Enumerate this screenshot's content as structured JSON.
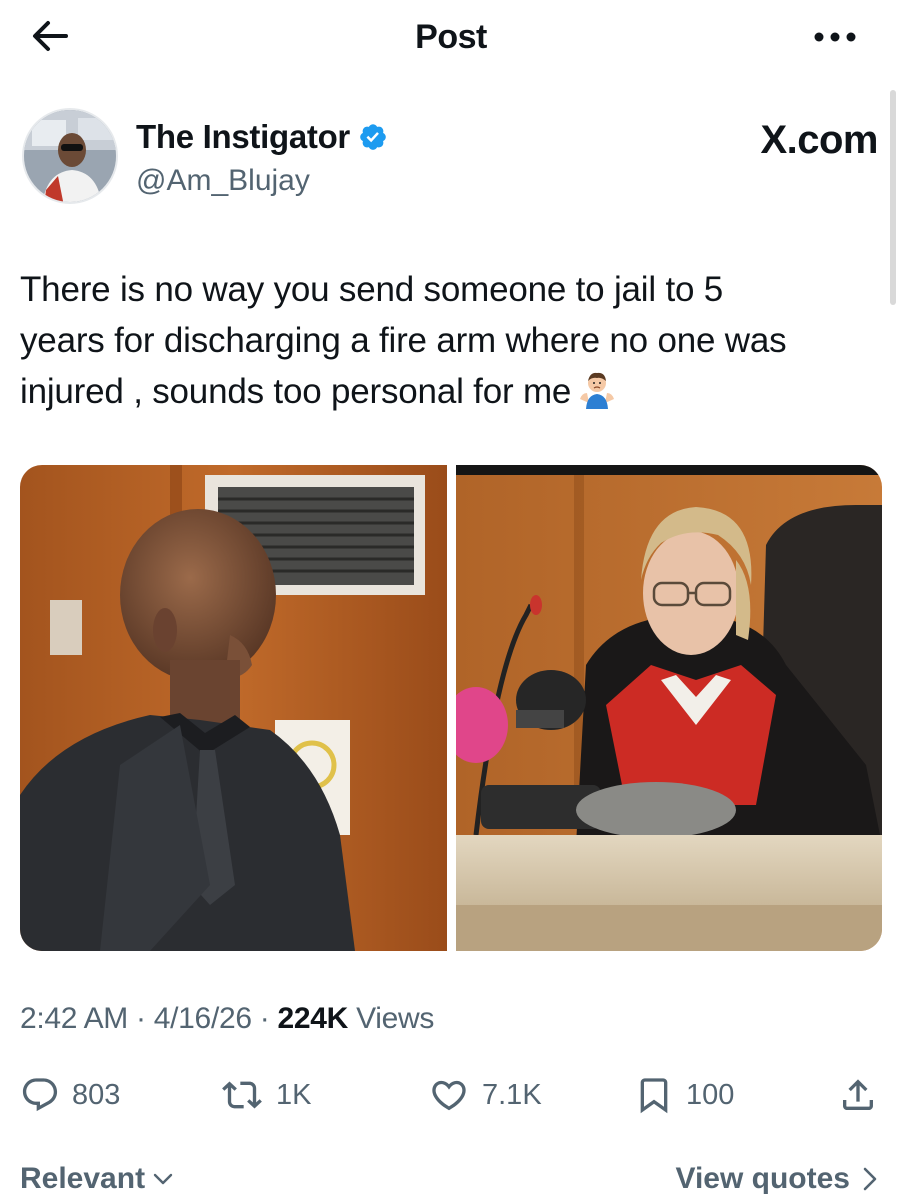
{
  "topbar": {
    "title": "Post"
  },
  "author": {
    "display_name": "The Instigator",
    "handle": "@Am_Blujay",
    "verified": true,
    "verified_color": "#1d9bf0"
  },
  "watermark": "X.com",
  "tweet": {
    "lines": [
      "There is no way you send someone to jail to 5",
      "years for discharging a fire arm where no one was",
      "injured , sounds too personal for me"
    ],
    "emoji": "person-shrugging"
  },
  "meta": {
    "time": "2:42 AM",
    "date": "4/16/26",
    "views_count": "224K",
    "views_label": "Views"
  },
  "actions": {
    "replies": "803",
    "reposts": "1K",
    "likes": "7.1K",
    "bookmarks": "100"
  },
  "footer": {
    "sort_label": "Relevant",
    "quotes_label": "View quotes"
  },
  "colors": {
    "text": "#0f1419",
    "secondary": "#536471"
  }
}
